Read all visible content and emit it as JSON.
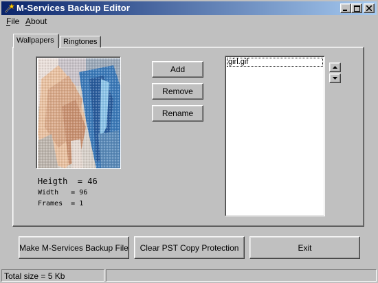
{
  "window": {
    "title": "M-Services Backup Editor",
    "title_gradient": [
      "#0a246a",
      "#a6caf0"
    ]
  },
  "menu": {
    "file": "File",
    "about": "About"
  },
  "tabs": [
    {
      "label": "Wallpapers",
      "active": true
    },
    {
      "label": "Ringtones",
      "active": false
    }
  ],
  "image_info": {
    "height_line": "Heigth  = 46",
    "width_line": "Width   = 96",
    "frames_line": "Frames  = 1"
  },
  "actions": {
    "add": "Add",
    "remove": "Remove",
    "rename": "Rename"
  },
  "file_list": {
    "items": [
      "girl.gif"
    ],
    "selected": "girl.gif"
  },
  "bottom_buttons": {
    "make_backup": "Make M-Services Backup File",
    "clear_protection": "Clear PST Copy Protection",
    "exit": "Exit"
  },
  "status_bar": {
    "total_size": "Total size = 5 Kb",
    "secondary": ""
  },
  "icons": {
    "app": "wand-icon",
    "minimize": "minimize-icon",
    "maximize": "maximize-icon",
    "close": "close-icon",
    "move_up": "arrow-up-icon",
    "move_down": "arrow-down-icon"
  }
}
